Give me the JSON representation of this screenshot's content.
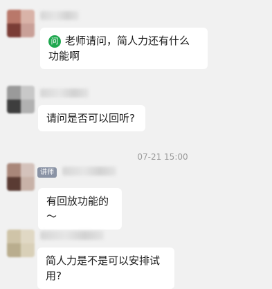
{
  "messages": [
    {
      "ask_icon_label": "问",
      "text": "老师请问，简人力还有什么功能啊"
    },
    {
      "text": "请问是否可以回听?"
    },
    {
      "role_badge": "讲师",
      "text": "有回放功能的～"
    },
    {
      "text": "简人力是不是可以安排试用?"
    }
  ],
  "timestamp": "07-21 15:00",
  "colors": {
    "background": "#f1f1f1",
    "bubble": "#ffffff",
    "ask_icon": "#1fa84f",
    "badge": "#8a93a5"
  }
}
